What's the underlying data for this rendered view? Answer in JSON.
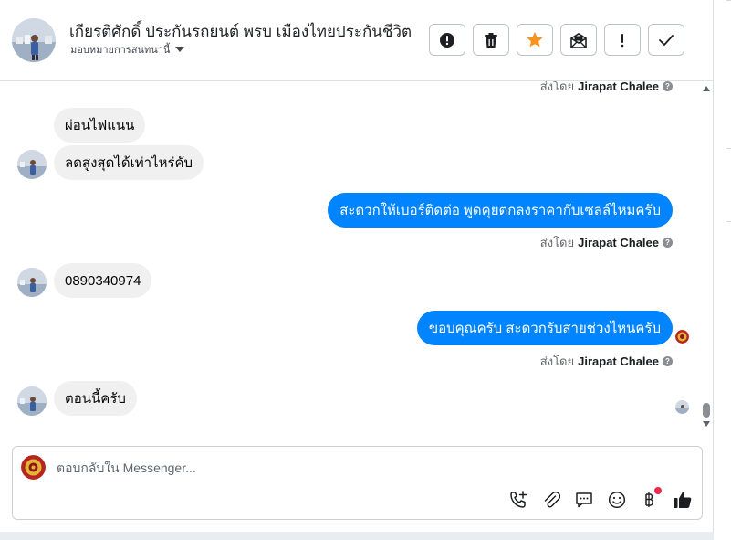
{
  "header": {
    "title": "เกียรติศักดิ์ ประกันรถยนต์ พรบ เมืองไทยประกันชีวิต",
    "assign_label": "มอบหมายการสนทนานี้",
    "actions": [
      {
        "name": "spam-button",
        "icon": "exclamation-circle-icon"
      },
      {
        "name": "delete-button",
        "icon": "trash-icon"
      },
      {
        "name": "star-button",
        "icon": "star-icon",
        "color": "#f7931e"
      },
      {
        "name": "mark-unread-button",
        "icon": "envelope-open-icon"
      },
      {
        "name": "follow-up-button",
        "icon": "exclamation-icon"
      },
      {
        "name": "mark-done-button",
        "icon": "check-icon"
      }
    ]
  },
  "sent_by_prefix": "ส่งโดย",
  "agent_name": "Jirapat Chalee",
  "messages": [
    {
      "direction": "in",
      "text": "ผ่อนไฟแนน"
    },
    {
      "direction": "in",
      "text": "ลดสูงสุดได้เท่าไหร่คับ"
    },
    {
      "direction": "out",
      "text": "สะดวกให้เบอร์ติดต่อ พูดคุยตกลงราคากับเซลล์ไหมครับ"
    },
    {
      "direction": "in",
      "text": "0890340974"
    },
    {
      "direction": "out",
      "text": "ขอบคุณครับ สะดวกรับสายช่วงไหนครับ"
    },
    {
      "direction": "in",
      "text": "ตอนนี้ครับ"
    }
  ],
  "composer": {
    "placeholder": "ตอบกลับใน Messenger...",
    "tools": [
      "phone-plus-icon",
      "paperclip-icon",
      "saved-reply-icon",
      "emoji-icon",
      "baht-icon",
      "thumbs-up-icon"
    ]
  },
  "colors": {
    "outgoing_bubble": "#0084ff",
    "incoming_bubble": "#f0f0f0",
    "accent_star": "#f7931e",
    "notification_dot": "#f02849"
  }
}
